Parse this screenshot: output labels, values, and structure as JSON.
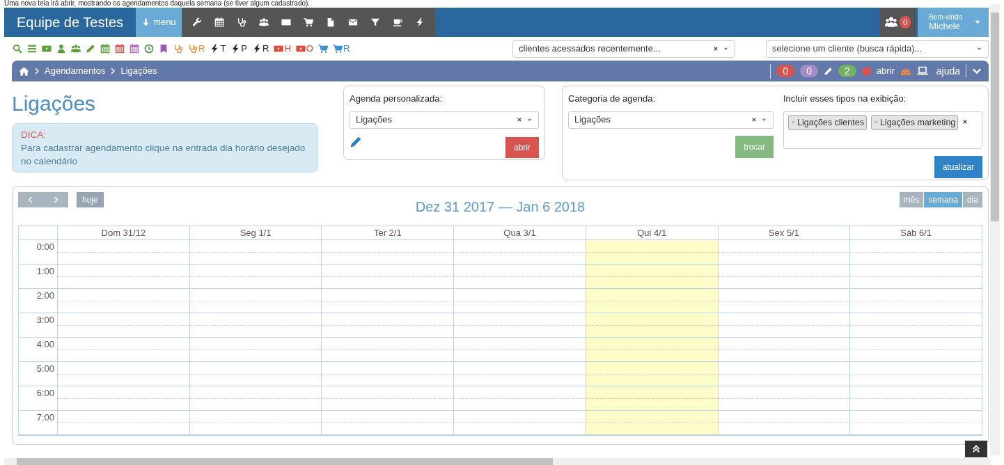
{
  "top_note": "Uma nova tela irá abrir, mostrando os agendamentos daquela semana (se tiver algum cadastrado).",
  "navbar": {
    "brand": "Equipe de Testes",
    "menu_button": "menu",
    "icons": [
      {
        "kind": "wrench"
      },
      {
        "kind": "calendar"
      },
      {
        "kind": "stethoscope"
      },
      {
        "kind": "users"
      },
      {
        "kind": "money"
      },
      {
        "kind": "cart"
      },
      {
        "kind": "file"
      },
      {
        "kind": "envelope"
      },
      {
        "kind": "filter"
      },
      {
        "kind": "cup"
      },
      {
        "kind": "bolt"
      }
    ],
    "notifications": "0",
    "welcome": "Bem-vindo",
    "user": "Michele"
  },
  "shortcuts": [
    {
      "kind": "search",
      "color": "#5a9e3a"
    },
    {
      "kind": "list",
      "color": "#5a9e3a"
    },
    {
      "kind": "money",
      "color": "#5a9e3a"
    },
    {
      "kind": "user",
      "color": "#5a9e3a"
    },
    {
      "kind": "users",
      "color": "#5a9e3a"
    },
    {
      "kind": "pencil",
      "color": "#5a9e3a"
    },
    {
      "kind": "calendar",
      "color": "#5a9e3a"
    },
    {
      "kind": "calendar",
      "color": "#d9534f"
    },
    {
      "kind": "calendar",
      "color": "#b06cb8"
    },
    {
      "kind": "clock",
      "color": "#3e8e3e"
    },
    {
      "kind": "bookmark",
      "color": "#9b59b6"
    },
    {
      "kind": "stethoscope",
      "color": "#f08a3c"
    },
    {
      "kind": "stethoscope",
      "color": "#f08a3c",
      "letter": "R"
    },
    {
      "kind": "bolt",
      "color": "#222222",
      "letter": "T"
    },
    {
      "kind": "bolt",
      "color": "#222222",
      "letter": "P"
    },
    {
      "kind": "bolt",
      "color": "#222222",
      "letter": "R"
    },
    {
      "kind": "money",
      "color": "#dd4b39",
      "letter": "H"
    },
    {
      "kind": "money",
      "color": "#dd4b39",
      "letter": "O"
    },
    {
      "kind": "cart",
      "color": "#3a8fd0"
    },
    {
      "kind": "cart",
      "color": "#3a8fd0",
      "letter": "R"
    }
  ],
  "recent_clients": {
    "value": "clientes acessados recentemente..."
  },
  "client_search": {
    "placeholder": "selecione um cliente (busca rápida)..."
  },
  "breadcrumb": [
    "Agendamentos",
    "Ligações"
  ],
  "status": [
    {
      "kind": "badge",
      "text": "0",
      "color": "#d9534f"
    },
    {
      "kind": "badge",
      "text": "0",
      "color": "#a38bc9"
    },
    {
      "kind": "pencil"
    },
    {
      "kind": "badge",
      "text": "2",
      "color": "#72b063"
    },
    {
      "kind": "dot",
      "text": "abrir",
      "color": "#d9534f"
    },
    {
      "kind": "gauge"
    },
    {
      "kind": "laptop",
      "text": "ajuda"
    }
  ],
  "page_title": "Ligações",
  "tip": {
    "title": "DICA:",
    "text": "Para cadastrar agendamento clique na entrada dia horário desejado no calendário"
  },
  "custom_agenda": {
    "label": "Agenda personalizada:",
    "value": "Ligações",
    "button": "abrir"
  },
  "category": {
    "label": "Categoria de agenda:",
    "value": "Ligações",
    "button": "trocar"
  },
  "include_types": {
    "label": "Incluir esses tipos na exibição:",
    "tags": [
      "Ligações clientes",
      "Ligações marketing"
    ],
    "button": "atualizar"
  },
  "calendar": {
    "today_button": "hoje",
    "today_disabled": true,
    "title": "Dez 31 2017 — Jan 6 2018",
    "views": [
      {
        "label": "mês",
        "selected": false
      },
      {
        "label": "semana",
        "selected": true
      },
      {
        "label": "dia",
        "selected": false
      }
    ],
    "days": [
      {
        "label": "Dom 31/12",
        "today": false
      },
      {
        "label": "Seg 1/1",
        "today": false
      },
      {
        "label": "Ter 2/1",
        "today": false
      },
      {
        "label": "Qua 3/1",
        "today": false
      },
      {
        "label": "Qui 4/1",
        "today": true
      },
      {
        "label": "Sex 5/1",
        "today": false
      },
      {
        "label": "Sáb 6/1",
        "today": false
      }
    ],
    "hours": [
      "0:00",
      "1:00",
      "2:00",
      "3:00",
      "4:00",
      "5:00",
      "6:00",
      "7:00"
    ]
  }
}
